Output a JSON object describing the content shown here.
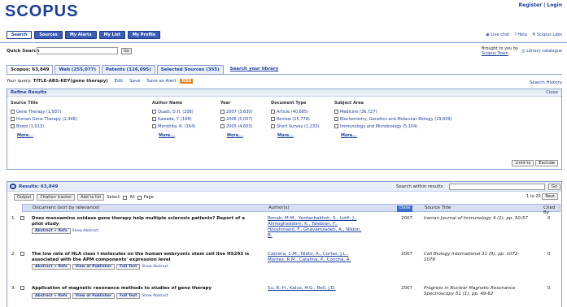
{
  "brand": {
    "logo": "SCOPUS"
  },
  "top_links": {
    "register": "Register",
    "separator": " | ",
    "login": "Login"
  },
  "nav": {
    "items": [
      "Search",
      "Sources",
      "My Alerts",
      "My List",
      "My Profile"
    ]
  },
  "top_tools": [
    "Live chat",
    "Help",
    "Scopus Labs"
  ],
  "quick_search": {
    "label": "Quick Search",
    "value": "",
    "go": "Go"
  },
  "brought_by": {
    "line1": "Brought to you by",
    "line2": "Scopus Team"
  },
  "library_catalogue": "Library catalogue",
  "tabs": [
    {
      "label": "Scopus: 63,849"
    },
    {
      "label": "Web (255,077)"
    },
    {
      "label": "Patents (126,095)"
    },
    {
      "label": "Selected Sources (355)"
    }
  ],
  "search_library": "Search your library",
  "query": {
    "prefix": "Your query:",
    "text": "TITLE-ABS-KEY(gene therapy)",
    "edit": "Edit",
    "save": "Save",
    "alert": "Save as Alert",
    "rss": "RSS"
  },
  "search_history": "Search History",
  "refine": {
    "title": "Refine Results",
    "close": "Close",
    "columns": [
      {
        "header": "Source Title",
        "items": [
          "Gene Therapy (1,937)",
          "Human Gene Therapy (1,448)",
          "Blood (1,013)"
        ],
        "more": "More..."
      },
      {
        "header": "Author Name",
        "items": [
          "Quadi, D.H. (208)",
          "Kawada, Y. (168)",
          "Morishita, R. (164)"
        ],
        "more": "More..."
      },
      {
        "header": "Year",
        "items": [
          "2007 (3,630)",
          "2006 (5,057)",
          "2005 (4,603)"
        ],
        "more": "More..."
      },
      {
        "header": "Document Type",
        "items": [
          "Article (40,685)",
          "Review (15,778)",
          "Short Survey (1,233)"
        ],
        "more": "More..."
      },
      {
        "header": "Subject Area",
        "items": [
          "Medicine (36,727)",
          "Biochemistry, Genetics and Molecular Biology (29,609)",
          "Immunology and Microbiology (5,104)"
        ],
        "more": "More..."
      }
    ],
    "limit_to": "Limit to",
    "exclude": "Exclude"
  },
  "results": {
    "title": "Results: 63,849",
    "search_within": "Search within results",
    "go": "Go",
    "toolbar": [
      "Output",
      "Citation tracker",
      "Add to list"
    ],
    "select_label": "Select:",
    "select_all": "All",
    "select_page": "Page",
    "pager": "1 to 20",
    "next": "Next",
    "columns": {
      "document": "Document (sort by relevance)",
      "authors": "Author(s)",
      "date": "Date",
      "source": "Source Title",
      "cited": "Cited By"
    },
    "rows": [
      {
        "num": "1.",
        "title": "Does monoamine oxidase gene therapy help multiple sclerosis patients? Report of a pilot study",
        "authors": "Bonab, M.M., Yazdanbakhsh, S., Lotfi, J., Alimoghaddom, K., Talebian, F., Hooshmand, F., Ghavamzadeh, A., Nikbin, B.",
        "year": "2007",
        "source": "Iranian Journal of Immunology 4 (1), pp. 50-57",
        "cited": "0",
        "buttons": [
          "Abstract + Refs"
        ],
        "show_abstract": "Show Abstract"
      },
      {
        "num": "2.",
        "title": "The low rate of HLA class I molecules on the human embryonic stem cell line HS293 is associated with the APM components' expression level",
        "authors": "Cabrera, C.M., Nieto, A., Cortes, J.L., Montes, R.M., Catalina, P., Concha, A.",
        "year": "2007",
        "source": "Cell Biology International 31 (9), pp. 1072-1078",
        "cited": "0",
        "buttons": [
          "Abstract + Refs",
          "View at Publisher",
          "Full Text"
        ],
        "show_abstract": "Show Abstract"
      },
      {
        "num": "3.",
        "title": "Application of magnetic resonance methods to studies of gene therapy",
        "authors": "Su, R.-H., Kalus, H.G., Bell, J.D.",
        "year": "2007",
        "source": "Progress in Nuclear Magnetic Resonance Spectroscopy 51 (1), pp. 49-62",
        "cited": "0",
        "buttons": [
          "Abstract + Refs",
          "View at Publisher",
          "Full Text"
        ],
        "show_abstract": "Show Abstract"
      }
    ]
  }
}
